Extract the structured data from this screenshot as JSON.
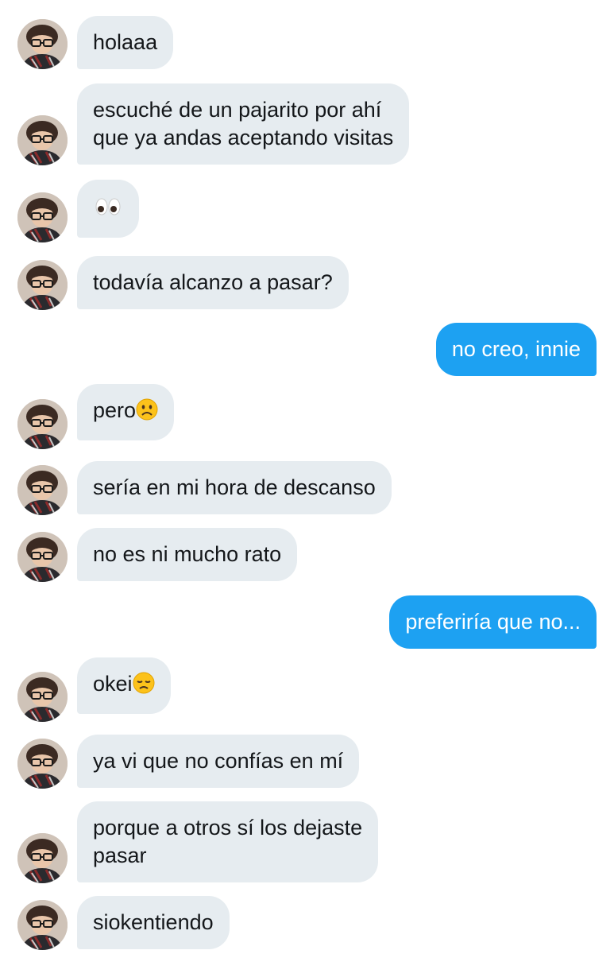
{
  "conversation": {
    "messages": [
      {
        "side": "in",
        "text": "holaaa"
      },
      {
        "side": "in",
        "text": "escuché de un pajarito por ahí\nque ya andas aceptando visitas"
      },
      {
        "side": "in",
        "text": "",
        "emoji": "eyes-emoji"
      },
      {
        "side": "in",
        "text": "todavía alcanzo a pasar?"
      },
      {
        "side": "out",
        "text": "no creo, innie"
      },
      {
        "side": "in",
        "text": "pero",
        "emoji": "slightly-frowning-face-emoji"
      },
      {
        "side": "in",
        "text": "sería en mi hora de descanso"
      },
      {
        "side": "in",
        "text": "no es ni mucho rato"
      },
      {
        "side": "out",
        "text": "preferiría que no..."
      },
      {
        "side": "in",
        "text": "okei",
        "emoji": "disappointed-face-emoji"
      },
      {
        "side": "in",
        "text": "ya vi que no confías en mí"
      },
      {
        "side": "in",
        "text": "porque a otros sí los dejaste\npasar"
      },
      {
        "side": "in",
        "text": "siokentiendo"
      }
    ]
  },
  "colors": {
    "incoming_bubble": "#e6ecf0",
    "outgoing_bubble": "#1da1f2",
    "incoming_text": "#14171a",
    "outgoing_text": "#ffffff"
  }
}
